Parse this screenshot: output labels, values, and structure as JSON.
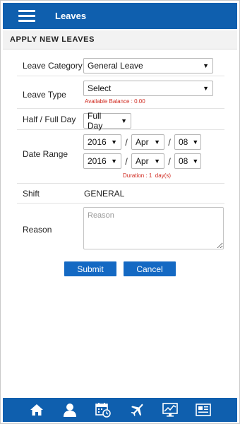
{
  "header": {
    "title": "Leaves",
    "menu_icon": "hamburger-menu-icon"
  },
  "section": {
    "title": "APPLY NEW LEAVES"
  },
  "form": {
    "leave_category": {
      "label": "Leave Category",
      "value": "General Leave"
    },
    "leave_type": {
      "label": "Leave Type",
      "value": "Select",
      "note": "Available Balance : 0.00"
    },
    "half_full_day": {
      "label": "Half / Full Day",
      "value": "Full Day"
    },
    "date_range": {
      "label": "Date Range",
      "from": {
        "year": "2016",
        "month": "Apr",
        "day": "08"
      },
      "to": {
        "year": "2016",
        "month": "Apr",
        "day": "08"
      },
      "separator": "/",
      "duration": "Duration : 1  day(s)"
    },
    "shift": {
      "label": "Shift",
      "value": "GENERAL"
    },
    "reason": {
      "label": "Reason",
      "placeholder": "Reason"
    }
  },
  "buttons": {
    "submit": "Submit",
    "cancel": "Cancel"
  },
  "colors": {
    "primary": "#0f5fae",
    "button": "#1469c3",
    "note": "#d02a20"
  },
  "bottom_nav": [
    "home-icon",
    "user-icon",
    "calendar-clock-icon",
    "airplane-icon",
    "chart-monitor-icon",
    "newspaper-icon"
  ]
}
